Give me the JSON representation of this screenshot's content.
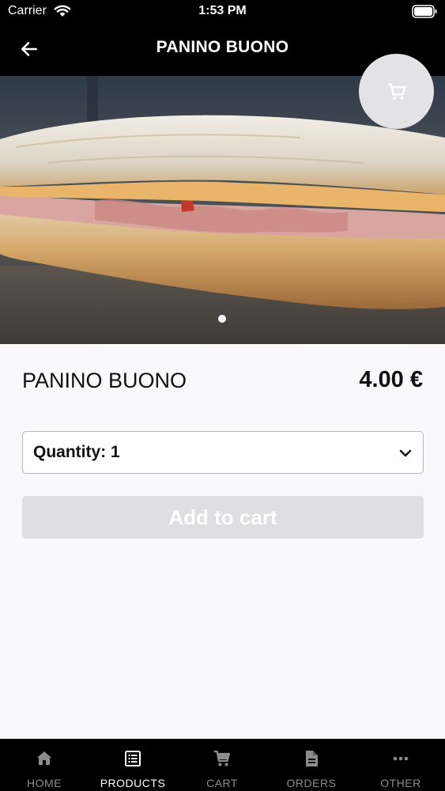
{
  "status_bar": {
    "carrier": "Carrier",
    "time": "1:53 PM"
  },
  "header": {
    "title": "PANINO BUONO",
    "back_icon": "arrow-left-icon"
  },
  "hero": {
    "image": "panino sandwich photo",
    "cart_icon": "cart-icon",
    "active_slide": 1,
    "slide_count": 1
  },
  "product": {
    "name": "PANINO BUONO",
    "price": "4.00 €",
    "quantity_label": "Quantity: 1",
    "add_to_cart": "Add to cart"
  },
  "tabs": [
    {
      "label": "HOME",
      "icon": "home-icon",
      "active": false
    },
    {
      "label": "PRODUCTS",
      "icon": "list-icon",
      "active": true
    },
    {
      "label": "CART",
      "icon": "cart-icon",
      "active": false
    },
    {
      "label": "ORDERS",
      "icon": "document-icon",
      "active": false
    },
    {
      "label": "OTHER",
      "icon": "more-icon",
      "active": false
    }
  ],
  "colors": {
    "header_bg": "#000000",
    "page_bg": "#f9f8fb",
    "button_disabled": "#dfdfe1",
    "tab_active": "#ffffff",
    "tab_inactive": "#8c8c8c"
  }
}
